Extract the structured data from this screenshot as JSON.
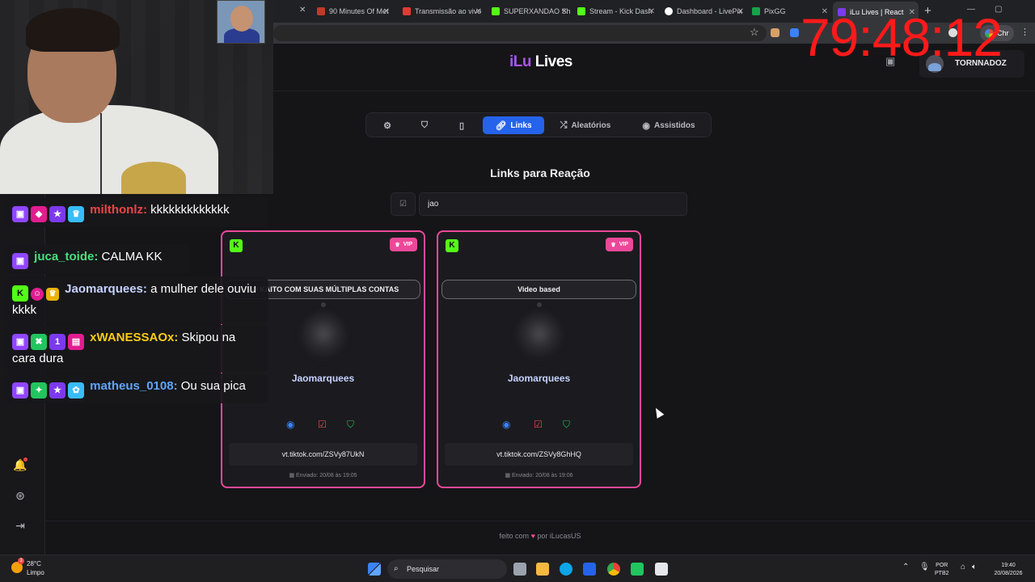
{
  "browser": {
    "tabs": [
      {
        "label": "90 Minutes Of Met",
        "color": "#c0392b"
      },
      {
        "label": "Transmissão ao vivo",
        "color": "#e53935"
      },
      {
        "label": "SUPERXANDAO Sh",
        "color": "#53fc18"
      },
      {
        "label": "Stream - Kick Dash",
        "color": "#53fc18"
      },
      {
        "label": "Dashboard - LivePix",
        "color": "#ffffff"
      },
      {
        "label": "PixGG",
        "color": "#16a34a"
      },
      {
        "label": "iLu Lives | React",
        "color": "#7c3aed"
      }
    ],
    "new_tab": "+",
    "profile_label": "Chr"
  },
  "app": {
    "logo_i": "iLu",
    "logo_rest": "Lives",
    "username": "TORNNADOZ",
    "nav": [
      {
        "label": "",
        "icon": "gear-icon",
        "glyph": "⚙"
      },
      {
        "label": "",
        "icon": "shield-icon",
        "glyph": "⛉"
      },
      {
        "label": "",
        "icon": "tablet-icon",
        "glyph": "▯"
      },
      {
        "label": "Links",
        "icon": "link-icon",
        "glyph": "🔗"
      },
      {
        "label": "Aleatórios",
        "icon": "shuffle-icon",
        "glyph": "⤮"
      },
      {
        "label": "Assistidos",
        "icon": "eye-icon",
        "glyph": "◉"
      }
    ],
    "section_title": "Links para Reação",
    "search_value": "jao",
    "cards": [
      {
        "platform_letter": "K",
        "vip_label": "VIP",
        "title": "EO KAITO COM SUAS MÚLTIPLAS CONTAS",
        "username": "Jaomarquees",
        "link": "vt.tiktok.com/ZSVy87UkN",
        "sent": "Enviado: 20/08 às 19:05"
      },
      {
        "platform_letter": "K",
        "vip_label": "VIP",
        "title": "Video based",
        "username": "Jaomarquees",
        "link": "vt.tiktok.com/ZSVy8GhHQ",
        "sent": "Enviado: 20/08 às 19:06"
      }
    ],
    "footer_prefix": "feito com",
    "footer_heart": "♥",
    "footer_suffix": "por iLucasUS"
  },
  "overlay": {
    "timer": "79:48:12",
    "chat": [
      {
        "user": "milthonlz:",
        "user_color": "#ef4444",
        "text": "kkkkkkkkkkkkk"
      },
      {
        "user": "juca_toide:",
        "user_color": "#4ade80",
        "text": "CALMA KK"
      },
      {
        "user": "Jaomarquees:",
        "user_color": "#c7d2fe",
        "text": "a mulher dele ouviu kkkk"
      },
      {
        "user": "xWANESSAOx:",
        "user_color": "#facc15",
        "text": "Skipou na cara dura"
      },
      {
        "user": "matheus_0108:",
        "user_color": "#60a5fa",
        "text": "Ou sua pica"
      }
    ]
  },
  "taskbar": {
    "temperature": "28°C",
    "weather": "Limpo",
    "weather_badge": "3",
    "search_placeholder": "Pesquisar",
    "lang": "POR",
    "layout": "PTB2",
    "time": "19:40",
    "date": "20/08/2026"
  }
}
